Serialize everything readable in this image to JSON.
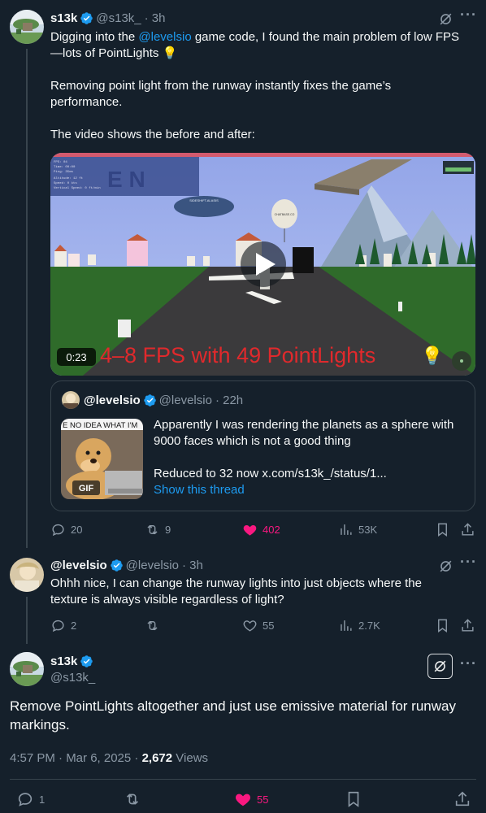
{
  "tweet1": {
    "name": "s13k",
    "handle": "@s13k_",
    "time": "· 3h",
    "line1_a": "Digging into the ",
    "line1_mention": "@levelsio",
    "line1_b": " game code, I found the main problem of low FPS",
    "line2": "—lots of PointLights",
    "para2_l1": "Removing point light from the runway instantly fixes the game’s",
    "para2_l2": "performance.",
    "para3": "The video shows the before and after:",
    "video": {
      "duration": "0:23",
      "overlay_text": "4–8 FPS with 49 PointLights",
      "blimp_label": "SIDESHIFT.AI.ASIS",
      "balloon_label": "CHATBASE.CO"
    },
    "quote": {
      "name": "@levelsio",
      "handle": "@levelsio",
      "time": "· 22h",
      "gif_caption": "E NO IDEA WHAT I'M",
      "gif_badge": "GIF",
      "line1": "Apparently I was rendering the planets as a sphere with",
      "line2": "9000 faces which is not a good thing",
      "line3": "Reduced to 32 now  x.com/s13k_/status/1...",
      "show_thread": "Show this thread"
    },
    "stats": {
      "replies": "20",
      "reposts": "9",
      "likes": "402",
      "views": "53K"
    }
  },
  "tweet2": {
    "name": "@levelsio",
    "handle": "@levelsio",
    "time": "· 3h",
    "line1": "Ohhh nice, I can change the runway lights into just objects where the",
    "line2": "texture is always visible regardless of light?",
    "stats": {
      "replies": "2",
      "reposts": "",
      "likes": "55",
      "views": "2.7K"
    }
  },
  "main": {
    "name": "s13k",
    "handle": "@s13k_",
    "line1": "Remove PointLights altogether and just use emissive material for runway",
    "line2": "markings.",
    "time": "4:57 PM · Mar 6, 2025 · ",
    "views_count": "2,672",
    "views_label": " Views",
    "stats": {
      "replies": "1",
      "likes": "55"
    }
  },
  "colors": {
    "bg": "#15202b",
    "accent": "#1d9bf0",
    "like": "#f91880",
    "muted": "#8b98a5",
    "border": "#38444d"
  }
}
